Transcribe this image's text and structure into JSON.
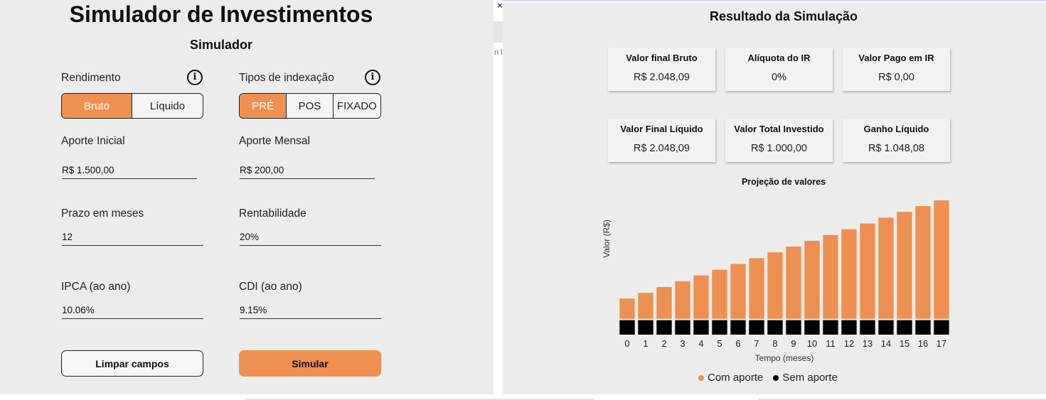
{
  "simulator": {
    "title": "Simulador de Investimentos",
    "subtitle": "Simulador",
    "rendimento": {
      "label": "Rendimento",
      "options": [
        "Bruto",
        "Líquido"
      ],
      "selected": "Bruto"
    },
    "indexacao": {
      "label": "Tipos de indexação",
      "options": [
        "PRÉ",
        "POS",
        "FIXADO"
      ],
      "selected": "PRÉ"
    },
    "info_icon_glyph": "i",
    "fields": {
      "aporte_inicial": {
        "label": "Aporte Inicial",
        "value": "R$ 1.500,00"
      },
      "aporte_mensal": {
        "label": "Aporte Mensal",
        "value": "R$ 200,00"
      },
      "prazo": {
        "label": "Prazo em meses",
        "value": "12"
      },
      "rentabilidade": {
        "label": "Rentabilidade",
        "value": "20%"
      },
      "ipca": {
        "label": "IPCA (ao ano)",
        "value": "10.06%"
      },
      "cdi": {
        "label": "CDI (ao ano)",
        "value": "9.15%"
      }
    },
    "buttons": {
      "clear": "Limpar campos",
      "simulate": "Simular"
    }
  },
  "results": {
    "title": "Resultado da Simulação",
    "cards": [
      {
        "label": "Valor final Bruto",
        "value": "R$ 2.048,09"
      },
      {
        "label": "Alíquota do IR",
        "value": "0%"
      },
      {
        "label": "Valor Pago em IR",
        "value": "R$ 0,00"
      },
      {
        "label": "Valor Final Líquido",
        "value": "R$ 2.048,09"
      },
      {
        "label": "Valor Total Investido",
        "value": "R$ 1.000,00"
      },
      {
        "label": "Ganho Líquido",
        "value": "R$ 1.048,08"
      }
    ]
  },
  "chart_data": {
    "type": "bar",
    "title": "Projeção de valores",
    "xlabel": "Tempo (meses)",
    "ylabel": "Valor (R$)",
    "categories": [
      "0",
      "1",
      "2",
      "3",
      "4",
      "5",
      "6",
      "7",
      "8",
      "9",
      "10",
      "11",
      "12",
      "13",
      "14",
      "15",
      "16",
      "17"
    ],
    "series": [
      {
        "name": "Com aporte",
        "color": "#ee9051",
        "values": [
          28,
          36,
          44,
          52,
          60,
          68,
          76,
          84,
          92,
          100,
          108,
          116,
          124,
          132,
          140,
          148,
          156,
          164
        ]
      },
      {
        "name": "Sem aporte",
        "color": "#000000",
        "values": [
          20,
          20,
          20,
          20,
          20,
          20,
          20,
          20,
          20,
          20,
          20,
          20,
          20,
          20,
          20,
          20,
          20,
          20
        ]
      }
    ],
    "stacked": true,
    "ylim": [
      0,
      184
    ],
    "grid": false,
    "legend": "bottom"
  },
  "background_artifacts": {
    "close_glyph": "×",
    "clipped_text": "n li"
  }
}
